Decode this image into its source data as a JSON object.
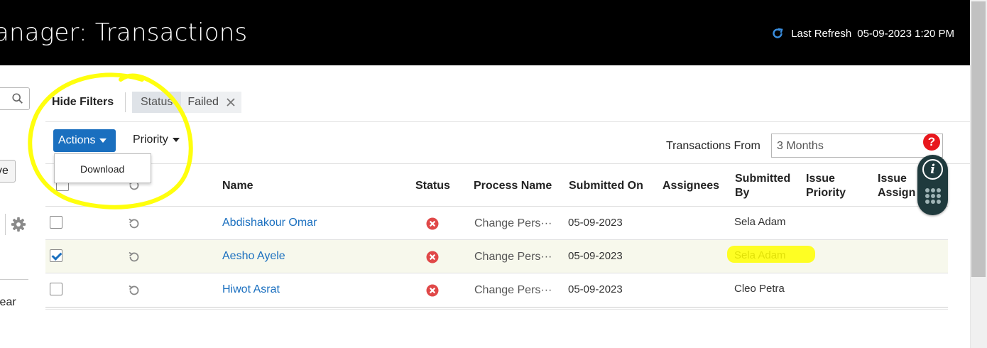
{
  "header": {
    "title": "anager: Transactions",
    "last_refresh_label": "Last Refresh",
    "last_refresh_value": "05-09-2023 1:20 PM",
    "refresh_icon": "refresh-icon"
  },
  "left_panel": {
    "save_label": "ve",
    "clear_label": "lear",
    "search_icon": "search-icon",
    "settings_icon": "gear-icon"
  },
  "filters": {
    "hide_filters_label": "Hide Filters",
    "chip_key": "Status",
    "chip_value": "Failed",
    "remove_icon": "close-icon"
  },
  "toolbar": {
    "actions_label": "Actions",
    "priority_label": "Priority",
    "actions_menu": [
      "Download"
    ],
    "transactions_from_label": "Transactions From",
    "transactions_from_value": "3 Months",
    "help_glyph": "?"
  },
  "table": {
    "columns": {
      "name": "Name",
      "status": "Status",
      "process_name": "Process Name",
      "submitted_on": "Submitted On",
      "assignees": "Assignees",
      "submitted_by": "Submitted By",
      "issue_priority": "Issue Priority",
      "issue_assignee": "Issue Assign"
    },
    "rows": [
      {
        "selected": false,
        "name": "Abdishakour Omar",
        "status": "failed",
        "process": "Change Pers···",
        "submitted_on": "05-09-2023",
        "submitted_by": "Sela Adam"
      },
      {
        "selected": true,
        "name": "Aesho Ayele",
        "status": "failed",
        "process": "Change Pers···",
        "submitted_on": "05-09-2023",
        "submitted_by": "Sela Adam"
      },
      {
        "selected": false,
        "name": "Hiwot Asrat",
        "status": "failed",
        "process": "Change Pers···",
        "submitted_on": "05-09-2023",
        "submitted_by": "Cleo Petra"
      }
    ]
  },
  "assistant": {
    "info_glyph": "i",
    "apps_icon": "grid-dots-icon"
  },
  "colors": {
    "header_bg": "#000000",
    "accent": "#1a6fbf",
    "error": "#e04848",
    "highlight": "#ffff00",
    "selected_row": "#f7f8ec"
  }
}
